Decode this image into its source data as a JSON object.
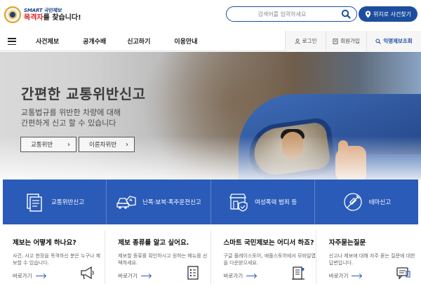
{
  "header": {
    "logo_small": "SMART 국민제보",
    "logo_red": "목격자",
    "logo_rest": "를 찾습니다!",
    "search_placeholder": "검색어를 입력하세요",
    "location_button": "위치로 사건찾기"
  },
  "nav": {
    "items": [
      {
        "label": "사건제보"
      },
      {
        "label": "공개수배"
      },
      {
        "label": "신고하기"
      },
      {
        "label": "이용안내"
      }
    ],
    "utils": [
      {
        "label": "로그인",
        "icon": "user-icon"
      },
      {
        "label": "회원가입",
        "icon": "document-icon"
      },
      {
        "label": "익명제보조회",
        "icon": "search-icon"
      }
    ]
  },
  "hero": {
    "title": "간편한 교통위반신고",
    "subtitle_line1": "교통법규를 위반한 차량에 대해",
    "subtitle_line2": "간편하게 신고 할 수 있습니다",
    "buttons": [
      {
        "label": "교통위반"
      },
      {
        "label": "이륜차위반"
      }
    ]
  },
  "services": [
    {
      "label": "교통위반신고",
      "icon": "form-icon"
    },
    {
      "label": "난폭·보복·폭주운전신고",
      "icon": "car-crash-icon"
    },
    {
      "label": "여성폭력 범죄 등",
      "icon": "shop-shield-icon"
    },
    {
      "label": "테마신고",
      "icon": "syringe-icon"
    }
  ],
  "cards": [
    {
      "title": "제보는 어떻게 하나요?",
      "desc": "사건, 사고 현장을 목격하신 분은 누구나 제보할 수 있습니다.",
      "link": "바로가기",
      "icon": "megaphone-icon"
    },
    {
      "title": "제보 종류를 알고 싶어요.",
      "desc": "제보할 종류를 확인하시고 원하는 메뉴를 선택하세요.",
      "link": "바로가기",
      "icon": "checklist-icon"
    },
    {
      "title": "스마트 국민제보는 어디서 하죠?",
      "desc": "구글 플레이스토어, 애플스토어에서 모바일앱을 다운받으세요.",
      "link": "바로가기",
      "icon": "building-icon"
    },
    {
      "title": "자주묻는질문",
      "desc": "신고나 제보에 대해 자주 묻는 질문에 대한 답변입니다.",
      "link": "바로가기",
      "icon": "chat-icon"
    }
  ]
}
